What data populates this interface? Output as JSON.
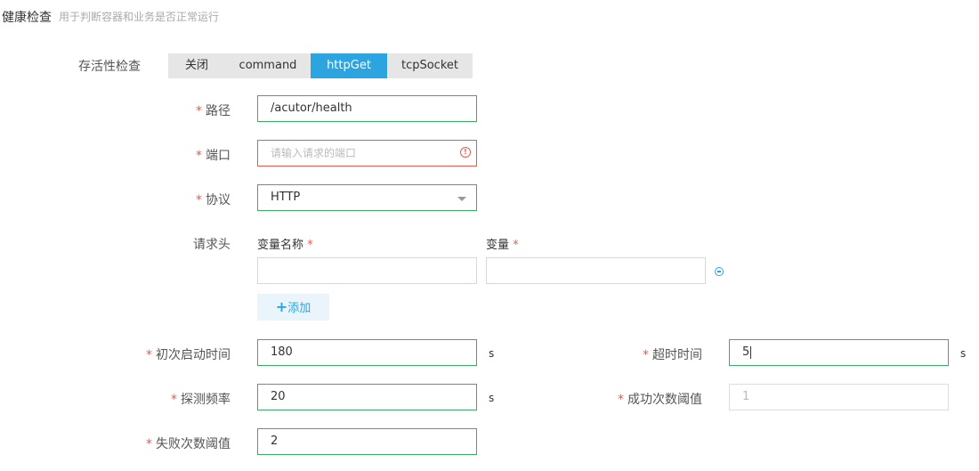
{
  "header": {
    "title": "健康检查",
    "subtitle": "用于判断容器和业务是否正常运行"
  },
  "liveness": {
    "label": "存活性检查",
    "options": [
      "关闭",
      "command",
      "httpGet",
      "tcpSocket"
    ],
    "selected": "httpGet"
  },
  "fields": {
    "path": {
      "label": "路径",
      "value": "/acutor/health"
    },
    "port": {
      "label": "端口",
      "placeholder": "请输入请求的端口"
    },
    "protocol": {
      "label": "协议",
      "value": "HTTP"
    },
    "request_header": {
      "label": "请求头",
      "name_col": "变量名称",
      "value_col": "变量",
      "add_label": "添加"
    },
    "initial_delay": {
      "label": "初次启动时间",
      "value": "180",
      "unit": "s"
    },
    "timeout": {
      "label": "超时时间",
      "value": "5",
      "unit": "s"
    },
    "period": {
      "label": "探测频率",
      "value": "20",
      "unit": "s"
    },
    "success_threshold": {
      "label": "成功次数阈值",
      "value": "1"
    },
    "failure_threshold": {
      "label": "失败次数阈值",
      "value": "2"
    }
  },
  "required_mark": "*",
  "colors": {
    "accent": "#2ba4e0",
    "valid_border": "#3cab63",
    "error": "#e85a4f"
  }
}
